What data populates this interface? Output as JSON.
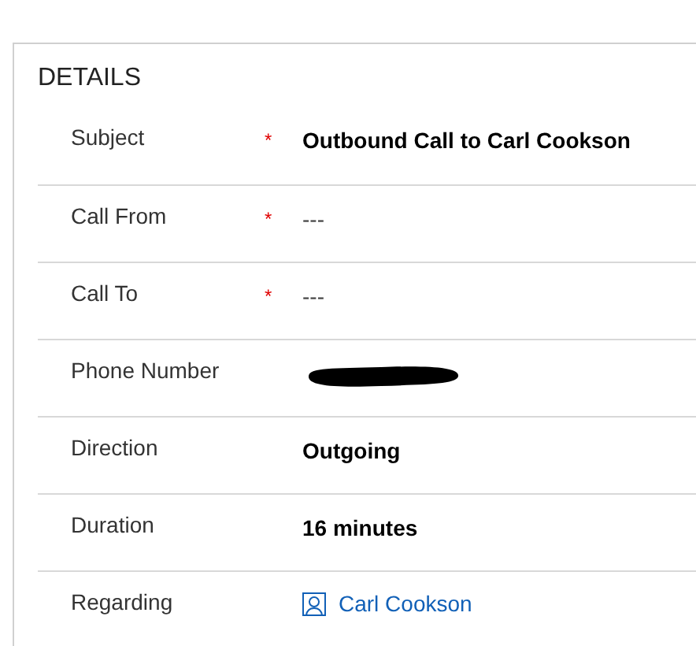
{
  "section": {
    "title": "DETAILS"
  },
  "fields": [
    {
      "label": "Subject",
      "required_mark": "*",
      "kind": "text",
      "value": "Outbound Call to Carl Cookson"
    },
    {
      "label": "Call From",
      "required_mark": "*",
      "kind": "empty",
      "value": "---"
    },
    {
      "label": "Call To",
      "required_mark": "*",
      "kind": "empty",
      "value": "---"
    },
    {
      "label": "Phone Number",
      "kind": "redacted"
    },
    {
      "label": "Direction",
      "kind": "text",
      "value": "Outgoing"
    },
    {
      "label": "Duration",
      "kind": "text",
      "value": "16 minutes"
    },
    {
      "label": "Regarding",
      "kind": "link",
      "value": "Carl Cookson"
    }
  ]
}
